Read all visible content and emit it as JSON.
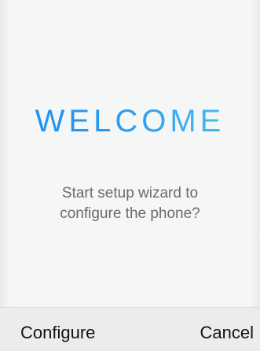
{
  "welcome": {
    "title": "WELCOME",
    "prompt_line1": "Start setup wizard to",
    "prompt_line2": "configure the phone?"
  },
  "softkeys": {
    "left_label": "Configure",
    "right_label": "Cancel"
  },
  "colors": {
    "accent_start": "#1e90ee",
    "accent_end": "#4fc6ef",
    "background": "#f5f6f6",
    "softkey_bar": "#ececec",
    "prompt_text": "#6b6b6b"
  }
}
